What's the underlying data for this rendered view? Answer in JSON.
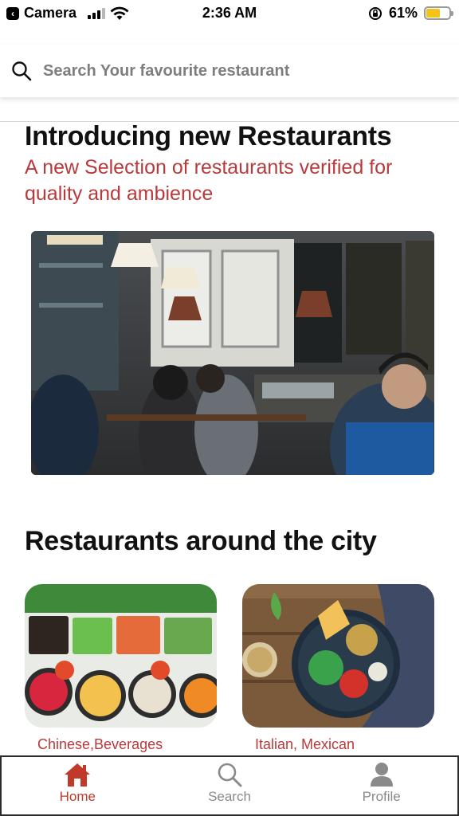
{
  "status_bar": {
    "back_app": "Camera",
    "time": "2:36 AM",
    "battery_percent": "61%",
    "battery_level": 0.61,
    "battery_color": "#f3c317"
  },
  "search": {
    "placeholder": "Search Your favourite restaurant",
    "icon": "search-icon"
  },
  "intro": {
    "title": "Introducing new Restaurants",
    "subtitle": "A new Selection of restaurants verified for quality and ambience",
    "image": "restaurant-interior-photo"
  },
  "city": {
    "title": "Restaurants around the city",
    "cards": [
      {
        "cuisine": "Chinese,Beverages",
        "image": "salad-bar-photo"
      },
      {
        "cuisine": "Italian, Mexican",
        "image": "salad-bowl-photo"
      }
    ]
  },
  "tab_bar": {
    "items": [
      {
        "label": "Home",
        "icon": "home-icon",
        "active": true
      },
      {
        "label": "Search",
        "icon": "search-icon",
        "active": false
      },
      {
        "label": "Profile",
        "icon": "profile-icon",
        "active": false
      }
    ]
  },
  "colors": {
    "accent": "#b83a3a",
    "tab_active": "#c0392b",
    "tab_inactive": "#8a8a8a"
  }
}
